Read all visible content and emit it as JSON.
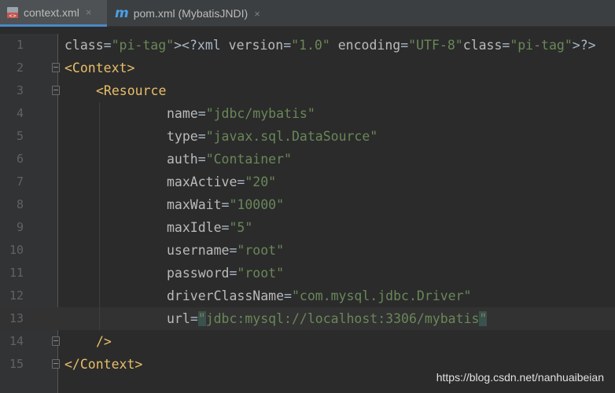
{
  "tabs": [
    {
      "label": "context.xml",
      "active": true,
      "icon": "xml-file-icon"
    },
    {
      "label": "pom.xml (MybatisJNDI)",
      "active": false,
      "icon": "maven-icon"
    }
  ],
  "tab_close_glyph": "×",
  "lines": [
    {
      "num": "1",
      "code": "<?xml version=\"1.0\" encoding=\"UTF-8\"?>"
    },
    {
      "num": "2",
      "code": "<Context>"
    },
    {
      "num": "3",
      "code": "<Resource"
    },
    {
      "num": "4",
      "code": "name=\"jdbc/mybatis\""
    },
    {
      "num": "5",
      "code": "type=\"javax.sql.DataSource\""
    },
    {
      "num": "6",
      "code": "auth=\"Container\""
    },
    {
      "num": "7",
      "code": "maxActive=\"20\""
    },
    {
      "num": "8",
      "code": "maxWait=\"10000\""
    },
    {
      "num": "9",
      "code": "maxIdle=\"5\""
    },
    {
      "num": "10",
      "code": "username=\"root\""
    },
    {
      "num": "11",
      "code": "password=\"root\""
    },
    {
      "num": "12",
      "code": "driverClassName=\"com.mysql.jdbc.Driver\""
    },
    {
      "num": "13",
      "code": "url=\"jdbc:mysql://localhost:3306/mybatis\""
    },
    {
      "num": "14",
      "code": "/>"
    },
    {
      "num": "15",
      "code": "</Context>"
    }
  ],
  "current_line": "13",
  "watermark": "https://blog.csdn.net/nanhuaibeian",
  "colors": {
    "tag": "#e8bf6a",
    "attribute": "#bababa",
    "value": "#6a8759",
    "background": "#2b2b2b",
    "accent": "#4a88c7"
  }
}
